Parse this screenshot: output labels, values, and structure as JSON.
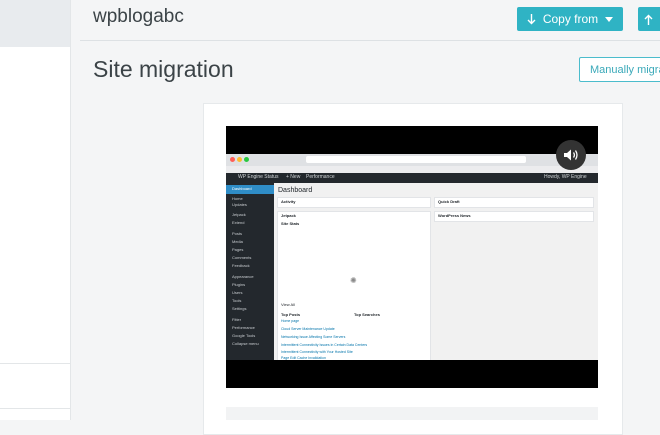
{
  "header": {
    "site_name": "wpblogabc",
    "copy_from_label": "Copy from",
    "copy_to_icon": "arrow-up-icon"
  },
  "page": {
    "title": "Site migration",
    "manual_button_label": "Manually migrate"
  },
  "video": {
    "volume_icon": "volume-icon",
    "wp_admin": {
      "site_label": "WP Engine Status",
      "new_label": "+ New",
      "performance_label": "Performance",
      "howdy_label": "Howdy, WP Engine",
      "dashboard_title": "Dashboard",
      "menu_items": [
        "Dashboard",
        "Home",
        "Updates",
        "Jetpack",
        "Extend",
        "Posts",
        "Media",
        "Pages",
        "Comments",
        "Feedback",
        "Appearance",
        "Plugins",
        "Users",
        "Tools",
        "Settings",
        "Fitter",
        "Performance",
        "Google Tools",
        "Collapse menu"
      ],
      "panels": {
        "activity": "Activity",
        "quick_draft": "Quick Draft",
        "jetpack": "Jetpack",
        "wordpress_news": "WordPress News",
        "site_stats": "Site Stats",
        "view_all": "View All",
        "top_posts": "Top Posts",
        "top_searches": "Top Searches"
      },
      "post_links": [
        "Home page",
        "Cloud Server Maintenance Update",
        "Networking Issue Affecting Some Servers",
        "Intermittent Connectivity Issues in Certain Data Centers",
        "Intermittent Connectivity with Your Hosted Site",
        "Page Edit Cache Invalidation",
        "Slow Pnmt and Loading Updates"
      ]
    }
  },
  "colors": {
    "accent": "#2fb3c4",
    "accent_text": "#3aa9b9",
    "wp_dark": "#23282d",
    "wp_blue": "#2f8dc7"
  }
}
